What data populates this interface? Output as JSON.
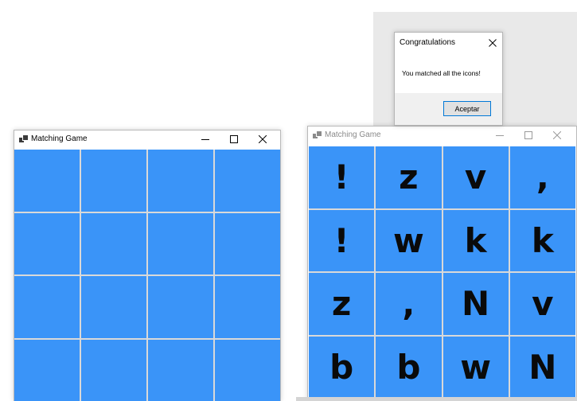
{
  "left_window": {
    "title": "Matching Game",
    "cells": [
      "",
      "",
      "",
      "",
      "",
      "",
      "",
      "",
      "",
      "",
      "",
      "",
      "",
      "",
      "",
      ""
    ]
  },
  "right_window": {
    "title": "Matching Game",
    "cells": [
      "!",
      "z",
      "v",
      ",",
      "!",
      "w",
      "k",
      "k",
      "z",
      ",",
      "N",
      "v",
      "b",
      "b",
      "w",
      "N"
    ]
  },
  "dialog": {
    "title": "Congratulations",
    "message": "You matched all the icons!",
    "ok_label": "Aceptar"
  },
  "colors": {
    "cell": "#3a94f8",
    "grid_line": "#d9d9d9",
    "dialog_button_border": "#0078d7"
  },
  "icons": {
    "minimize": "minimize-icon",
    "maximize": "maximize-icon",
    "close": "close-icon",
    "app": "app-icon"
  }
}
